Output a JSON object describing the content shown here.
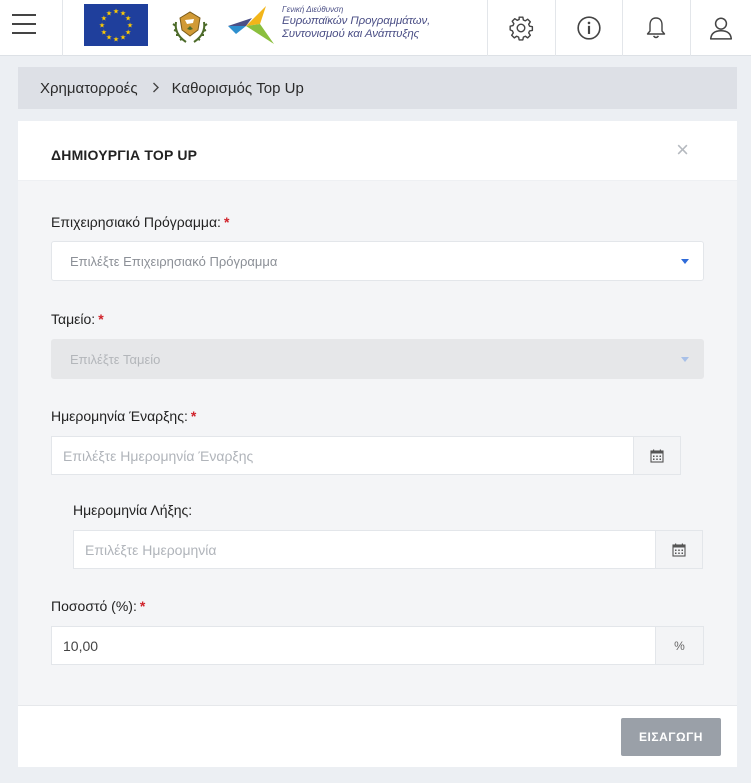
{
  "header": {
    "menu_icon": "hamburger-menu-icon",
    "dg_small": "Γενική Διεύθυνση",
    "dg_line1": "Ευρωπαϊκών Προγραμμάτων,",
    "dg_line2": "Συντονισμού και Ανάπτυξης",
    "icons": [
      "gear-icon",
      "info-icon",
      "bell-icon",
      "user-icon"
    ]
  },
  "breadcrumb": {
    "items": [
      "Χρηματορροές",
      "Καθορισμός Top Up"
    ],
    "separator": ">"
  },
  "form": {
    "title": "ΔΗΜΙΟΥΡΓΙΑ TOP UP",
    "close": "×",
    "program_label": "Επιχειρησιακό Πρόγραμμα:",
    "program_placeholder": "Επιλέξτε Επιχειρησιακό Πρόγραμμα",
    "fund_label": "Ταμείο:",
    "fund_placeholder": "Επιλέξτε Ταμείο",
    "start_label": "Ημερομηνία Έναρξης:",
    "start_placeholder": "Επιλέξτε Ημερομηνία Έναρξης",
    "end_label": "Ημερομηνία Λήξης:",
    "end_placeholder": "Επιλέξτε Ημερομηνία",
    "percent_label": "Ποσοστό (%):",
    "percent_value": "10,00",
    "percent_addon": "%",
    "required_mark": "*",
    "submit_label": "ΕΙΣΑΓΩΓΗ"
  },
  "colors": {
    "accent": "#2f6bd9",
    "required": "#d0222a",
    "submit_bg": "#9aa0a8",
    "eu_blue": "#1f3f9c",
    "eu_star": "#ffcc00"
  }
}
